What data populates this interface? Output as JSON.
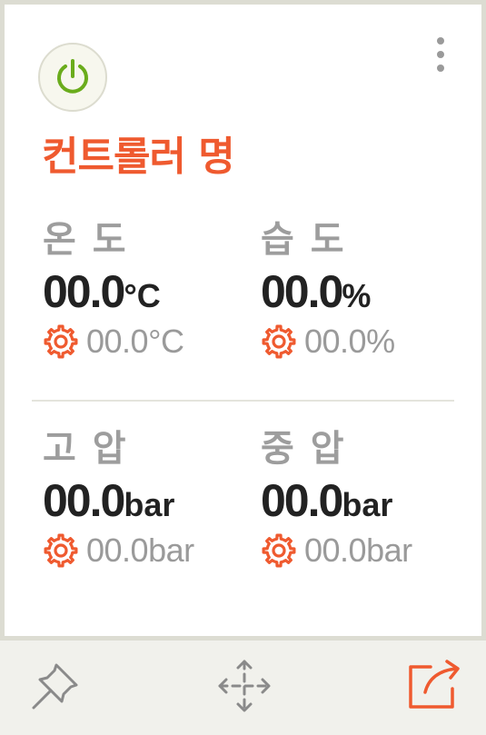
{
  "controller": {
    "name": "컨트롤러 명",
    "accent_color": "#ef5a2f",
    "power_icon": "power-icon",
    "power_color": "#6aac1c",
    "menu_icon": "kebab-menu-icon"
  },
  "sensors": [
    {
      "label": "온 도",
      "value": "00.0",
      "unit": "°C",
      "setpoint": "00.0°C",
      "setpoint_icon": "gear-icon"
    },
    {
      "label": "습 도",
      "value": "00.0",
      "unit": "%",
      "setpoint": "00.0%",
      "setpoint_icon": "gear-icon"
    },
    {
      "label": "고 압",
      "value": "00.0",
      "unit": "bar",
      "setpoint": "00.0bar",
      "setpoint_icon": "gear-icon"
    },
    {
      "label": "중 압",
      "value": "00.0",
      "unit": "bar",
      "setpoint": "00.0bar",
      "setpoint_icon": "gear-icon"
    }
  ],
  "footer": {
    "pin_icon": "pin-icon",
    "move_icon": "move-icon",
    "share_icon": "share-icon"
  }
}
